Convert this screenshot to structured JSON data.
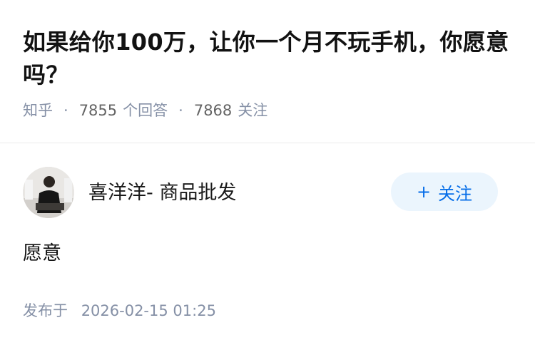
{
  "question": {
    "title": "如果给你100万，让你一个月不玩手机，你愿意吗？",
    "source": "知乎",
    "answer_count": "7855",
    "answer_count_label": "个回答",
    "follower_count": "7868",
    "follower_count_label": "关注"
  },
  "answer": {
    "author_name": "喜洋洋- 商品批发",
    "follow_button_label": "关注",
    "content": "愿意",
    "published_label": "发布于",
    "published_time": "2026-02-15 01:25"
  },
  "colors": {
    "primary_text": "#121212",
    "secondary_text": "#8590a6",
    "follow_button_bg": "#ebf5fd",
    "follow_button_text": "#056de8"
  },
  "icons": {
    "follow_icon": "plus-icon"
  }
}
